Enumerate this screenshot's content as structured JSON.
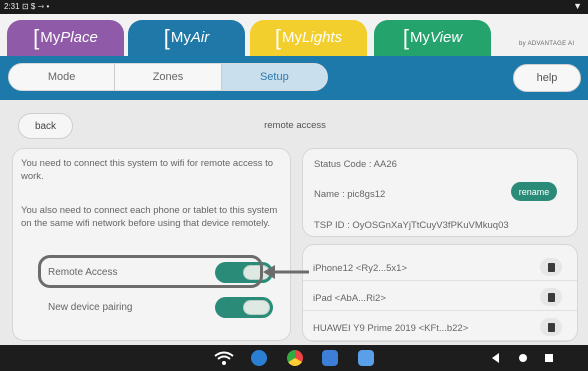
{
  "statusbar": {
    "time": "2:31",
    "extra": "⊡ $  ⇾ •",
    "battery": "▼"
  },
  "apptabs": [
    {
      "prefix": "My",
      "name": "Place"
    },
    {
      "prefix": "My",
      "name": "Air"
    },
    {
      "prefix": "My",
      "name": "Lights"
    },
    {
      "prefix": "My",
      "name": "View"
    }
  ],
  "brand": "by ADVANTAGE AI",
  "nav": {
    "segments": [
      "Mode",
      "Zones",
      "Setup"
    ],
    "active": "Setup",
    "help_label": "help"
  },
  "page": {
    "back_label": "back",
    "title": "remote access"
  },
  "remote": {
    "para1": "You need to connect this system to wifi for remote access to work.",
    "para2": "You also need to connect each phone or tablet to this system on the same wifi network before using that device remotely.",
    "toggles": [
      {
        "label": "Remote Access",
        "on": true
      },
      {
        "label": "New device pairing",
        "on": true
      }
    ]
  },
  "status": {
    "code": "Status Code : AA26",
    "name": "Name : pic8gs12",
    "rename_label": "rename",
    "tsp": "TSP ID : OyOSGnXaYjTtCuyV3fPKuVMkuq03"
  },
  "devices": [
    {
      "name": "iPhone12 <Ry2...5x1>"
    },
    {
      "name": "iPad <AbA...Ri2>"
    },
    {
      "name": "HUAWEI Y9 Prime 2019 <KFt...b22>"
    }
  ],
  "colors": {
    "header_blue": "#1e79ab",
    "toggle_green": "#2a8c78",
    "myplace_purple": "#8f5aa8",
    "myair_blue": "#1f78a8",
    "mylights_yellow": "#f2cf2c",
    "myview_green": "#25a36d"
  },
  "icons": {
    "dock": [
      "wifi-icon",
      "messenger-icon",
      "chrome-icon",
      "calendar-icon",
      "camera-icon"
    ]
  }
}
